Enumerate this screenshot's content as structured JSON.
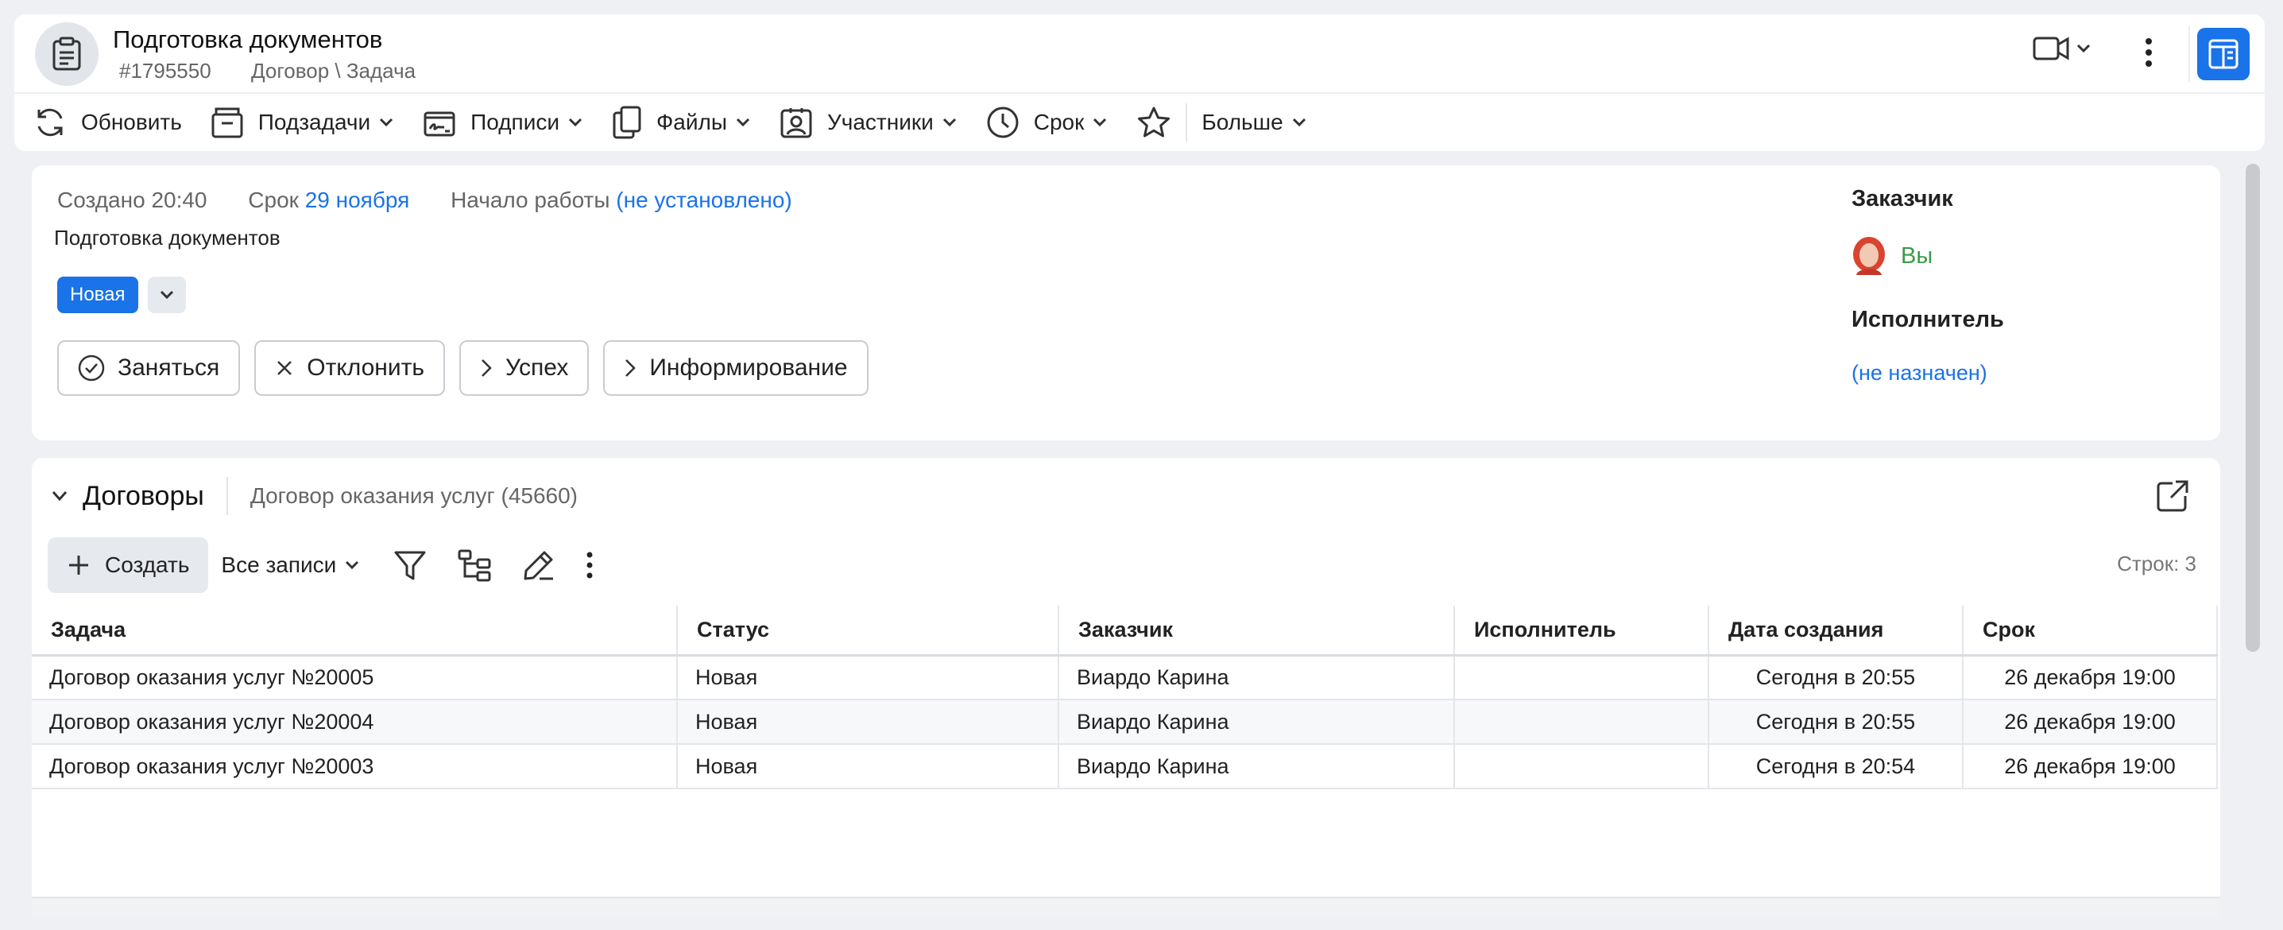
{
  "header": {
    "title": "Подготовка документов",
    "id": "#1795550",
    "path": "Договор \\ Задача"
  },
  "toolbar": {
    "refresh": "Обновить",
    "subtasks": "Подзадачи",
    "signatures": "Подписи",
    "files": "Файлы",
    "participants": "Участники",
    "deadline": "Срок",
    "more": "Больше"
  },
  "info": {
    "created_label": "Создано",
    "created_time": "20:40",
    "deadline_label": "Срок",
    "deadline_value": "29 ноября",
    "start_label": "Начало работы",
    "start_value": "(не установлено)",
    "description": "Подготовка документов",
    "status": "Новая",
    "actions": {
      "take": "Заняться",
      "decline": "Отклонить",
      "success": "Успех",
      "inform": "Информирование"
    },
    "client_label": "Заказчик",
    "client_name": "Вы",
    "executor_label": "Исполнитель",
    "executor_value": "(не назначен)"
  },
  "contracts": {
    "title": "Договоры",
    "subtitle": "Договор оказания услуг (45660)",
    "create": "Создать",
    "filter": "Все записи",
    "rows_count": "Строк: 3",
    "columns": {
      "task": "Задача",
      "status": "Статус",
      "client": "Заказчик",
      "executor": "Исполнитель",
      "created": "Дата создания",
      "deadline": "Срок"
    },
    "rows": [
      {
        "task": "Договор оказания услуг №20005",
        "status": "Новая",
        "client": "Виардо Карина",
        "executor": "",
        "created": "Сегодня в 20:55",
        "deadline": "26 декабря 19:00"
      },
      {
        "task": "Договор оказания услуг №20004",
        "status": "Новая",
        "client": "Виардо Карина",
        "executor": "",
        "created": "Сегодня в 20:55",
        "deadline": "26 декабря 19:00"
      },
      {
        "task": "Договор оказания услуг №20003",
        "status": "Новая",
        "client": "Виардо Карина",
        "executor": "",
        "created": "Сегодня в 20:54",
        "deadline": "26 декабря 19:00"
      }
    ]
  },
  "colors": {
    "accent": "#1a73e8",
    "client_green": "#3b9a48",
    "background": "#eef0f3"
  },
  "icons": [
    "clipboard-icon",
    "video-camera-icon",
    "kebab-icon",
    "split-panel-icon",
    "refresh-icon",
    "subtasks-icon",
    "signature-icon",
    "files-icon",
    "participants-icon",
    "clock-icon",
    "star-icon",
    "check-circle-icon",
    "close-icon",
    "chevron-right-icon",
    "external-link-icon",
    "plus-icon",
    "filter-icon",
    "hierarchy-icon",
    "pencil-icon"
  ]
}
